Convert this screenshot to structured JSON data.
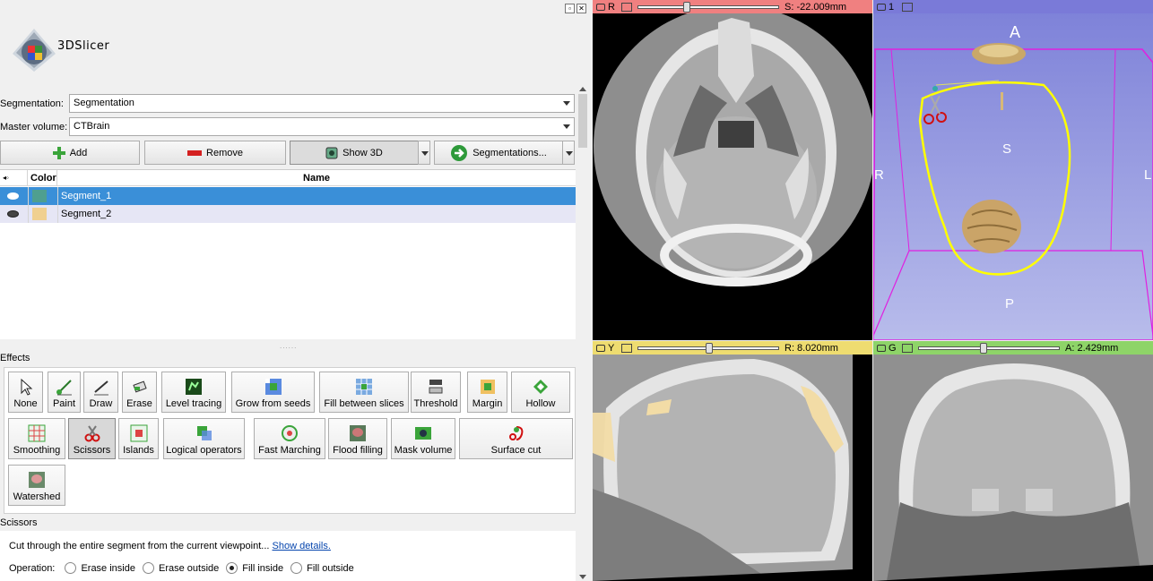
{
  "app": {
    "name": "3DSlicer"
  },
  "window_buttons": [
    "restore",
    "close"
  ],
  "segmentation": {
    "label": "Segmentation:",
    "value": "Segmentation"
  },
  "master_volume": {
    "label": "Master volume:",
    "value": "CTBrain"
  },
  "toolbar": {
    "add_label": "Add",
    "remove_label": "Remove",
    "show3d_label": "Show 3D",
    "segmentations_label": "Segmentations..."
  },
  "segment_table": {
    "columns": {
      "color": "Color",
      "name": "Name"
    },
    "rows": [
      {
        "name": "Segment_1",
        "color": "#4f9f8f",
        "selected": true
      },
      {
        "name": "Segment_2",
        "color": "#f0d090",
        "selected": false
      }
    ]
  },
  "effects": {
    "title": "Effects",
    "items": [
      {
        "label": "None",
        "icon": "cursor-icon"
      },
      {
        "label": "Paint",
        "icon": "paint-icon"
      },
      {
        "label": "Draw",
        "icon": "draw-icon"
      },
      {
        "label": "Erase",
        "icon": "erase-icon"
      },
      {
        "label": "Level tracing",
        "icon": "level-tracing-icon"
      },
      {
        "label": "Grow from seeds",
        "icon": "grow-seeds-icon"
      },
      {
        "label": "Fill between slices",
        "icon": "fill-slices-icon"
      },
      {
        "label": "Threshold",
        "icon": "threshold-icon"
      },
      {
        "label": "Margin",
        "icon": "margin-icon"
      },
      {
        "label": "Hollow",
        "icon": "hollow-icon"
      },
      {
        "label": "Smoothing",
        "icon": "smoothing-icon"
      },
      {
        "label": "Scissors",
        "icon": "scissors-icon",
        "active": true
      },
      {
        "label": "Islands",
        "icon": "islands-icon"
      },
      {
        "label": "Logical operators",
        "icon": "logical-ops-icon"
      },
      {
        "label": "Fast Marching",
        "icon": "fast-marching-icon"
      },
      {
        "label": "Flood filling",
        "icon": "flood-fill-icon"
      },
      {
        "label": "Mask volume",
        "icon": "mask-volume-icon"
      },
      {
        "label": "Surface cut",
        "icon": "surface-cut-icon"
      },
      {
        "label": "Watershed",
        "icon": "watershed-icon"
      }
    ]
  },
  "scissors": {
    "title": "Scissors",
    "description": "Cut through the entire segment from the current viewpoint...",
    "details_link": "Show details.",
    "operation_label": "Operation:",
    "options": [
      "Erase inside",
      "Erase outside",
      "Fill inside",
      "Fill outside"
    ],
    "selected_option": "Fill inside"
  },
  "views": {
    "red": {
      "letter": "R",
      "readout": "S: -22.009mm",
      "slider_fraction": 0.33,
      "color": "#f08080"
    },
    "threed": {
      "letter": "1",
      "color": "#7a7ad8",
      "orientation": {
        "top": "A",
        "bottom": "P",
        "left": "R",
        "right": "L",
        "center": "S"
      }
    },
    "yellow": {
      "letter": "Y",
      "readout": "R: 8.020mm",
      "slider_fraction": 0.5,
      "color": "#eedc70"
    },
    "green": {
      "letter": "G",
      "readout": "A: 2.429mm",
      "slider_fraction": 0.45,
      "color": "#8ed468"
    }
  }
}
